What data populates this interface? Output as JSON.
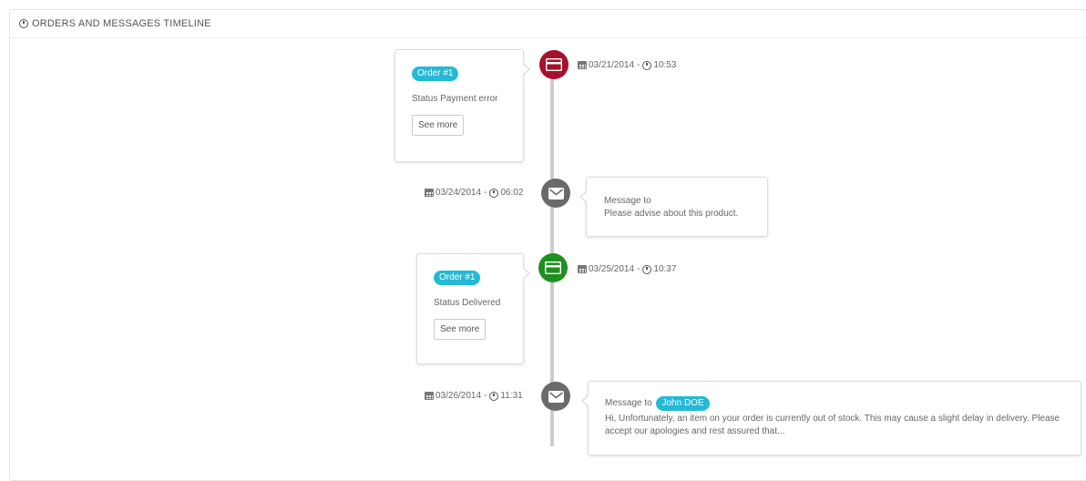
{
  "panel": {
    "title": "ORDERS AND MESSAGES TIMELINE"
  },
  "colors": {
    "payment_error": "#a8102c",
    "delivered": "#1f8f1f",
    "message": "#6a6a6a",
    "badge": "#25b9d7",
    "timeline_line": "#cccccc"
  },
  "timeline": [
    {
      "type": "order",
      "icon": "credit-card-icon",
      "badge": "Order #1",
      "status": "Status Payment error",
      "button": "See more",
      "date": "03/21/2014",
      "separator": "-",
      "time": "10:53"
    },
    {
      "type": "message",
      "icon": "envelope-icon",
      "title": "Message to",
      "text": "Please advise about this product.",
      "date": "03/24/2014",
      "separator": "-",
      "time": "06:02"
    },
    {
      "type": "order",
      "icon": "credit-card-icon",
      "badge": "Order #1",
      "status": "Status Delivered",
      "button": "See more",
      "date": "03/25/2014",
      "separator": "-",
      "time": "10:37"
    },
    {
      "type": "message",
      "icon": "envelope-icon",
      "title": "Message to",
      "recipient": "John DOE",
      "text": "Hi, Unfortunately, an item on your order is currently out of stock. This may cause a slight delay in delivery. Please accept our apologies and rest assured that...",
      "date": "03/26/2014",
      "separator": "-",
      "time": "11:31"
    }
  ]
}
